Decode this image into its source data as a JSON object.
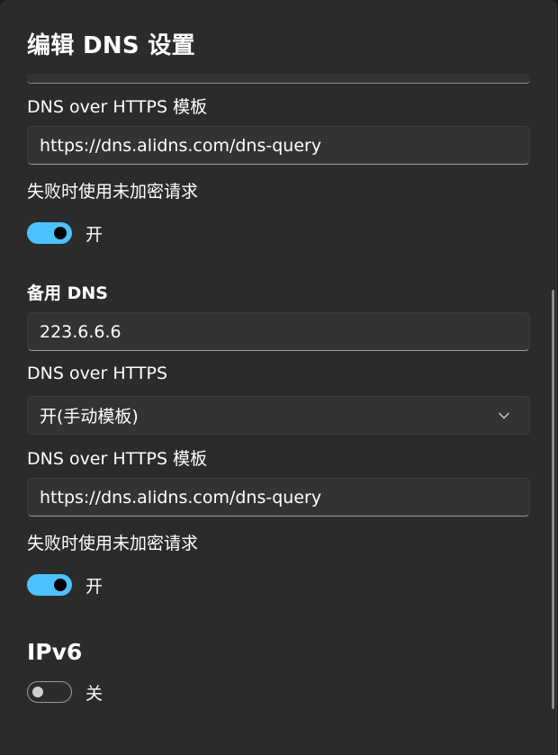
{
  "dialog": {
    "title": "编辑 DNS 设置"
  },
  "primary": {
    "doh_template_label": "DNS over HTTPS 模板",
    "doh_template_value": "https://dns.alidns.com/dns-query",
    "fallback_label": "失败时使用未加密请求",
    "fallback_state": "开",
    "fallback_on": true
  },
  "alternate": {
    "heading": "备用 DNS",
    "address_value": "223.6.6.6",
    "doh_label": "DNS over HTTPS",
    "doh_selected": "开(手动模板)",
    "doh_template_label": "DNS over HTTPS 模板",
    "doh_template_value": "https://dns.alidns.com/dns-query",
    "fallback_label": "失败时使用未加密请求",
    "fallback_state": "开",
    "fallback_on": true
  },
  "ipv6": {
    "heading": "IPv6",
    "state": "关",
    "on": false
  },
  "icons": {
    "dropdown": "chevron-down-icon"
  },
  "colors": {
    "accent": "#4cc2ff",
    "background": "#2b2b2b",
    "field": "#333333"
  }
}
